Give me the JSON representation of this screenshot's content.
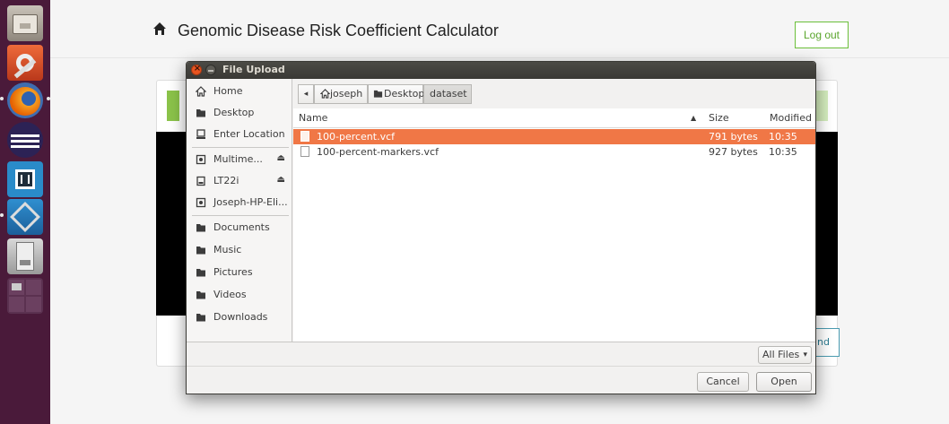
{
  "webpage": {
    "title": "Genomic Disease Risk Coefficient Calculator",
    "logout_label": "Log out",
    "upload_partial_label": "nd"
  },
  "dialog": {
    "title": "File Upload",
    "places": [
      {
        "label": "Home",
        "icon": "home-icon"
      },
      {
        "label": "Desktop",
        "icon": "folder-icon"
      },
      {
        "label": "Enter Location",
        "icon": "location-icon"
      },
      {
        "label": "Multime...",
        "icon": "media-icon",
        "eject": "⏏"
      },
      {
        "label": "LT22i",
        "icon": "drive-icon",
        "eject": "⏏"
      },
      {
        "label": "Joseph-HP-Eli...",
        "icon": "media-icon"
      },
      {
        "label": "Documents",
        "icon": "folder-icon"
      },
      {
        "label": "Music",
        "icon": "folder-icon"
      },
      {
        "label": "Pictures",
        "icon": "folder-icon"
      },
      {
        "label": "Videos",
        "icon": "folder-icon"
      },
      {
        "label": "Downloads",
        "icon": "folder-icon"
      }
    ],
    "path": {
      "back": "◂",
      "crumbs": [
        "joseph",
        "Desktop",
        "dataset"
      ]
    },
    "columns": {
      "name": "Name",
      "size": "Size",
      "modified": "Modified",
      "sort_indicator": "▲"
    },
    "files": [
      {
        "name": "100-percent.vcf",
        "size": "791 bytes",
        "modified": "10:35",
        "selected": true
      },
      {
        "name": "100-percent-markers.vcf",
        "size": "927 bytes",
        "modified": "10:35",
        "selected": false
      }
    ],
    "filter": {
      "label": "All Files",
      "arrow": "▾"
    },
    "buttons": {
      "cancel": "Cancel",
      "open": "Open"
    }
  },
  "colors": {
    "accent": "#f07746",
    "launcher_bg": "#4a1a3a",
    "logout_border": "#6bbf3a"
  }
}
